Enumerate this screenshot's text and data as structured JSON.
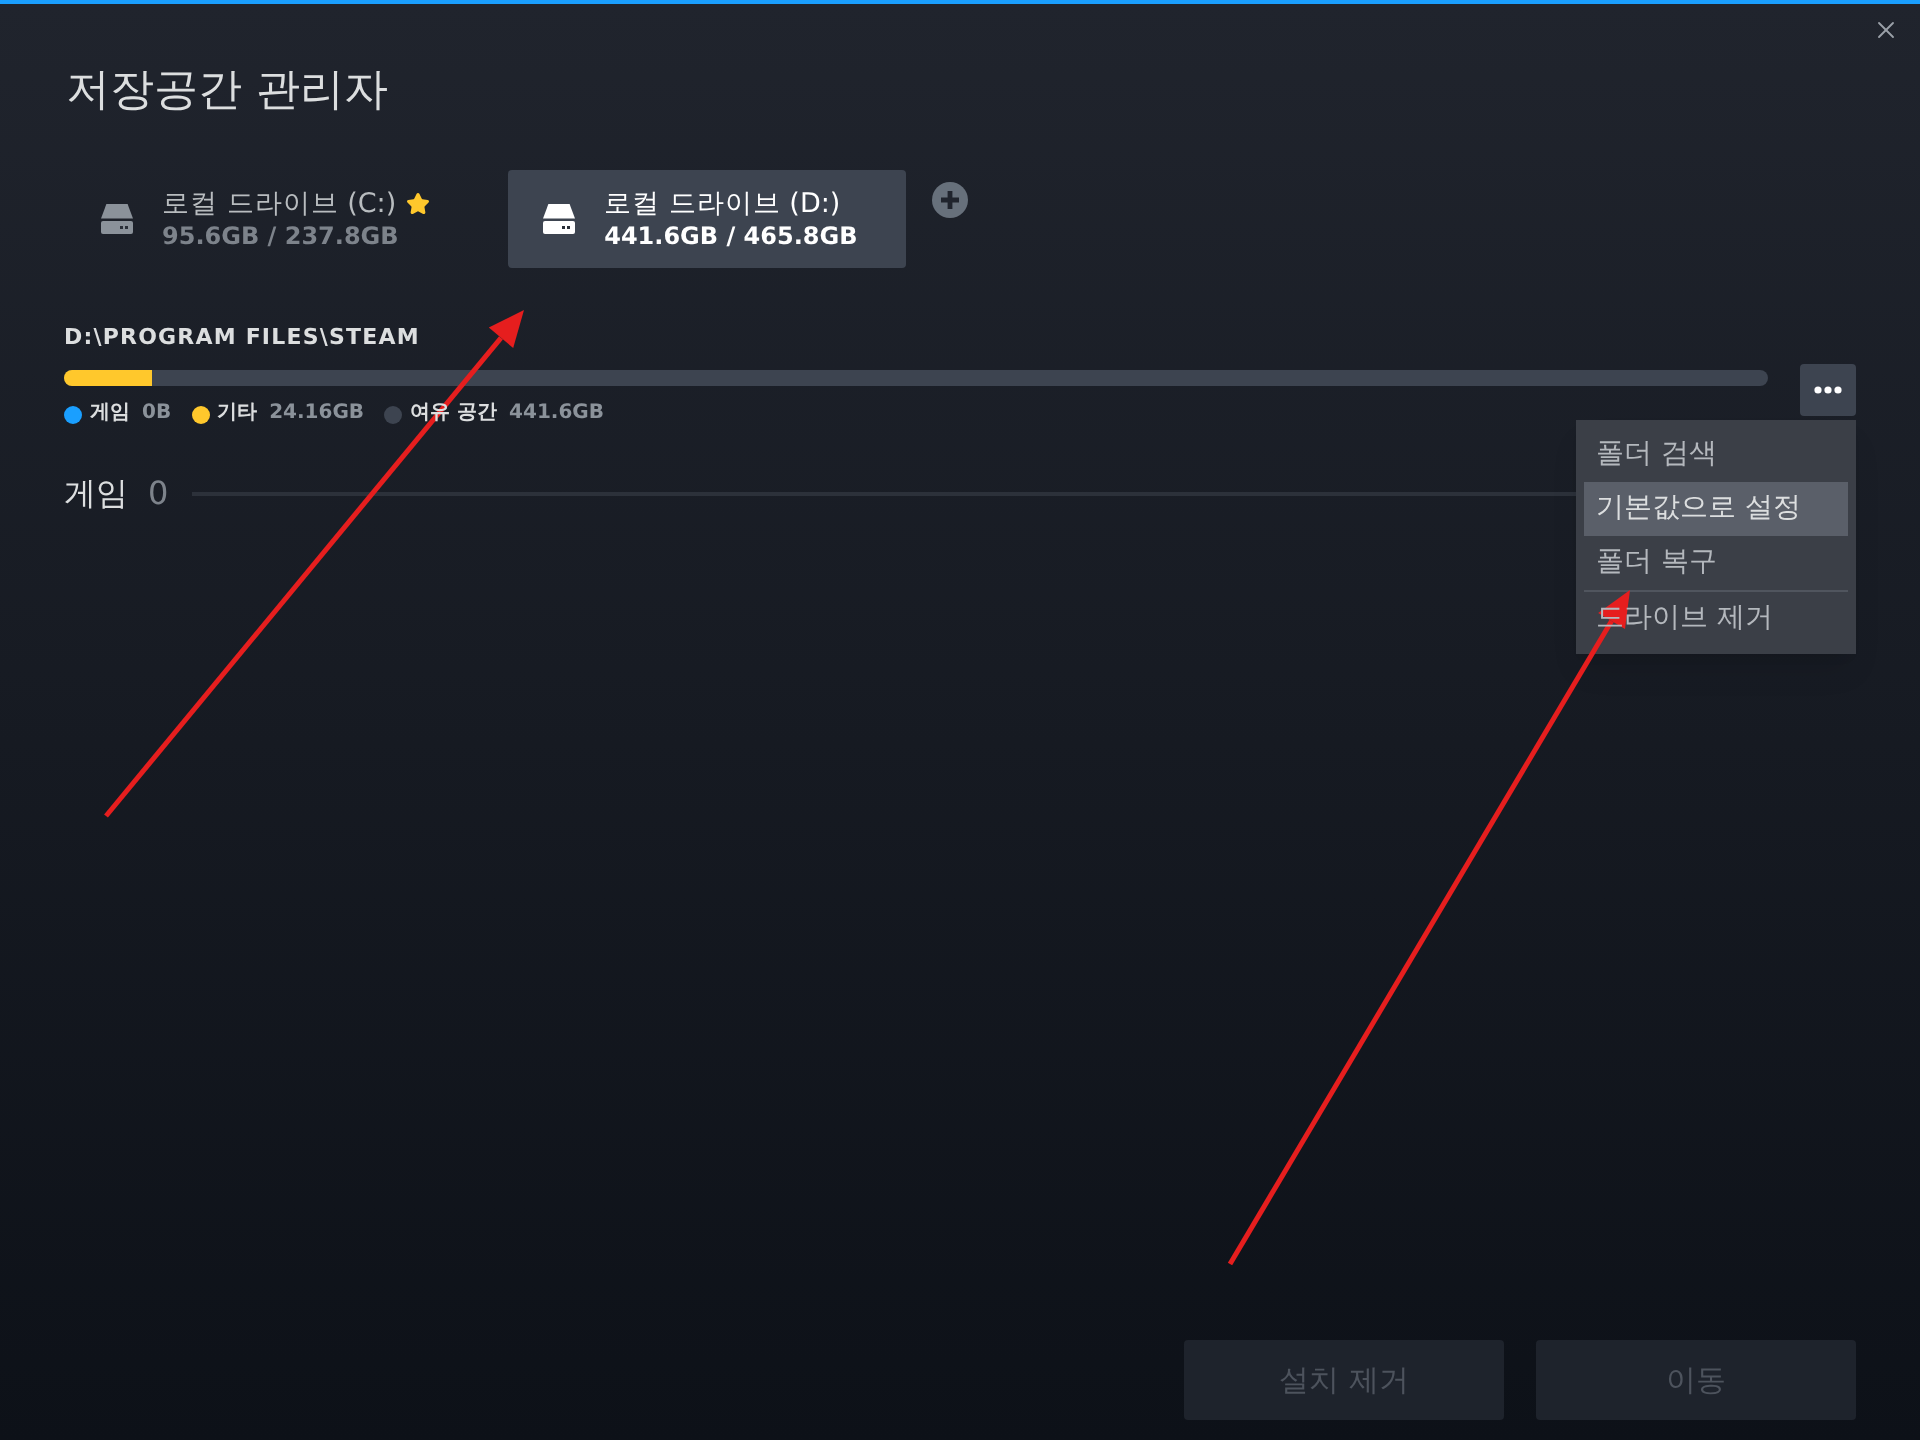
{
  "window": {
    "title": "저장공간 관리자"
  },
  "drives": [
    {
      "name": "로컬 드라이브 (C:)",
      "usage": "95.6GB / 237.8GB",
      "default": true,
      "selected": false
    },
    {
      "name": "로컬 드라이브 (D:)",
      "usage": "441.6GB / 465.8GB",
      "default": false,
      "selected": true
    }
  ],
  "folder": {
    "path": "D:\\PROGRAM FILES\\STEAM",
    "bar": {
      "segments": [
        {
          "color": "#ffc82c",
          "level": 0.052
        }
      ]
    },
    "legend": [
      {
        "label": "게임",
        "value": "0B",
        "color": "#1a9fff"
      },
      {
        "label": "기타",
        "value": "24.16GB",
        "color": "#ffc82c"
      },
      {
        "label": "여유 공간",
        "value": "441.6GB",
        "color": "#3d4450"
      }
    ]
  },
  "games": {
    "label": "게임",
    "count": "0"
  },
  "menu": {
    "open": true,
    "items": [
      {
        "label": "폴더 검색",
        "selected": false,
        "divider_above": false
      },
      {
        "label": "기본값으로 설정",
        "selected": true,
        "divider_above": false
      },
      {
        "label": "폴더 복구",
        "selected": false,
        "divider_above": false
      },
      {
        "label": "드라이브 제거",
        "selected": false,
        "divider_above": true
      }
    ]
  },
  "buttons": [
    {
      "label": "설치 제거",
      "disabled": true
    },
    {
      "label": "이동",
      "disabled": true
    }
  ]
}
